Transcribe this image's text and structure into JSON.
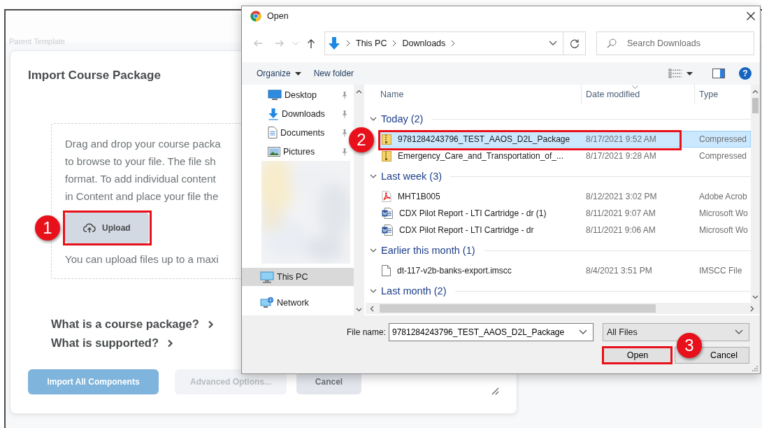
{
  "page": {
    "label": "Parent Template"
  },
  "import_dialog": {
    "title": "Import Course Package",
    "dropzone": {
      "lines": [
        "Drag and drop your course packa",
        "to browse to your file. The file sh",
        "format. To add individual content",
        "in Content and place your file the"
      ],
      "upload_button": {
        "label": "Upload",
        "callout": "1"
      },
      "note": "You can upload files up to a maxi"
    },
    "links": [
      "What is a course package?",
      "What is supported?"
    ],
    "buttons": [
      {
        "label": "Import All Components",
        "kind": "primary",
        "disabled": false
      },
      {
        "label": "Advanced Options...",
        "kind": "secondary",
        "disabled": true
      },
      {
        "label": "Cancel",
        "kind": "secondary",
        "disabled": false
      }
    ]
  },
  "open_dialog": {
    "title": "Open",
    "breadcrumb": [
      "This PC",
      "Downloads"
    ],
    "search": {
      "placeholder": "Search Downloads"
    },
    "toolbar": {
      "organize": "Organize",
      "new_folder": "New folder",
      "help": "?"
    },
    "nav_items": [
      {
        "kind": "desktop",
        "label": "Desktop",
        "pinned": true,
        "selected": false
      },
      {
        "kind": "downloads",
        "label": "Downloads",
        "pinned": true,
        "selected": false
      },
      {
        "kind": "documents",
        "label": "Documents",
        "pinned": true,
        "selected": false
      },
      {
        "kind": "pictures",
        "label": "Pictures",
        "pinned": true,
        "selected": false
      },
      {
        "kind": "picture"
      },
      {
        "kind": "computer",
        "label": "This PC",
        "pinned": false,
        "selected": true
      },
      {
        "kind": "network",
        "label": "Network",
        "pinned": false,
        "selected": false
      }
    ],
    "columns": [
      "Name",
      "Date modified",
      "Type"
    ],
    "groups": [
      {
        "label": "Today (2)",
        "expanded": true,
        "files": [
          {
            "kind": "zip",
            "name": "9781284243796_TEST_AAOS_D2L_Package",
            "date": "8/17/2021 9:52 AM",
            "type": "Compressed",
            "selected": true,
            "callout": "2"
          },
          {
            "kind": "zip",
            "name": "Emergency_Care_and_Transportation_of_...",
            "date": "8/17/2021 9:28 AM",
            "type": "Compressed",
            "selected": false
          }
        ]
      },
      {
        "label": "Last week (3)",
        "expanded": true,
        "files": [
          {
            "kind": "pdf",
            "name": "MHT1B005",
            "date": "8/12/2021 3:02 PM",
            "type": "Adobe Acrob",
            "selected": false
          },
          {
            "kind": "word",
            "name": "CDX Pilot Report - LTI Cartridge - dr (1)",
            "date": "8/11/2021 9:07 AM",
            "type": "Microsoft Wo",
            "selected": false
          },
          {
            "kind": "word",
            "name": "CDX Pilot Report - LTI Cartridge - dr",
            "date": "8/11/2021 9:06 AM",
            "type": "Microsoft Wo",
            "selected": false
          }
        ]
      },
      {
        "label": "Earlier this month (1)",
        "expanded": true,
        "files": [
          {
            "kind": "file",
            "name": "dt-117-v2b-banks-export.imscc",
            "date": "8/4/2021 3:51 PM",
            "type": "IMSCC File",
            "selected": false
          }
        ]
      },
      {
        "label": "Last month (2)",
        "expanded": true
      }
    ],
    "file_name_label": "File name:",
    "file_name": "9781284243796_TEST_AAOS_D2L_Package",
    "file_type": "All Files",
    "buttons": [
      {
        "label": "Open",
        "kind": "default",
        "callout": "3"
      },
      {
        "label": "Cancel",
        "kind": "normal"
      }
    ]
  }
}
